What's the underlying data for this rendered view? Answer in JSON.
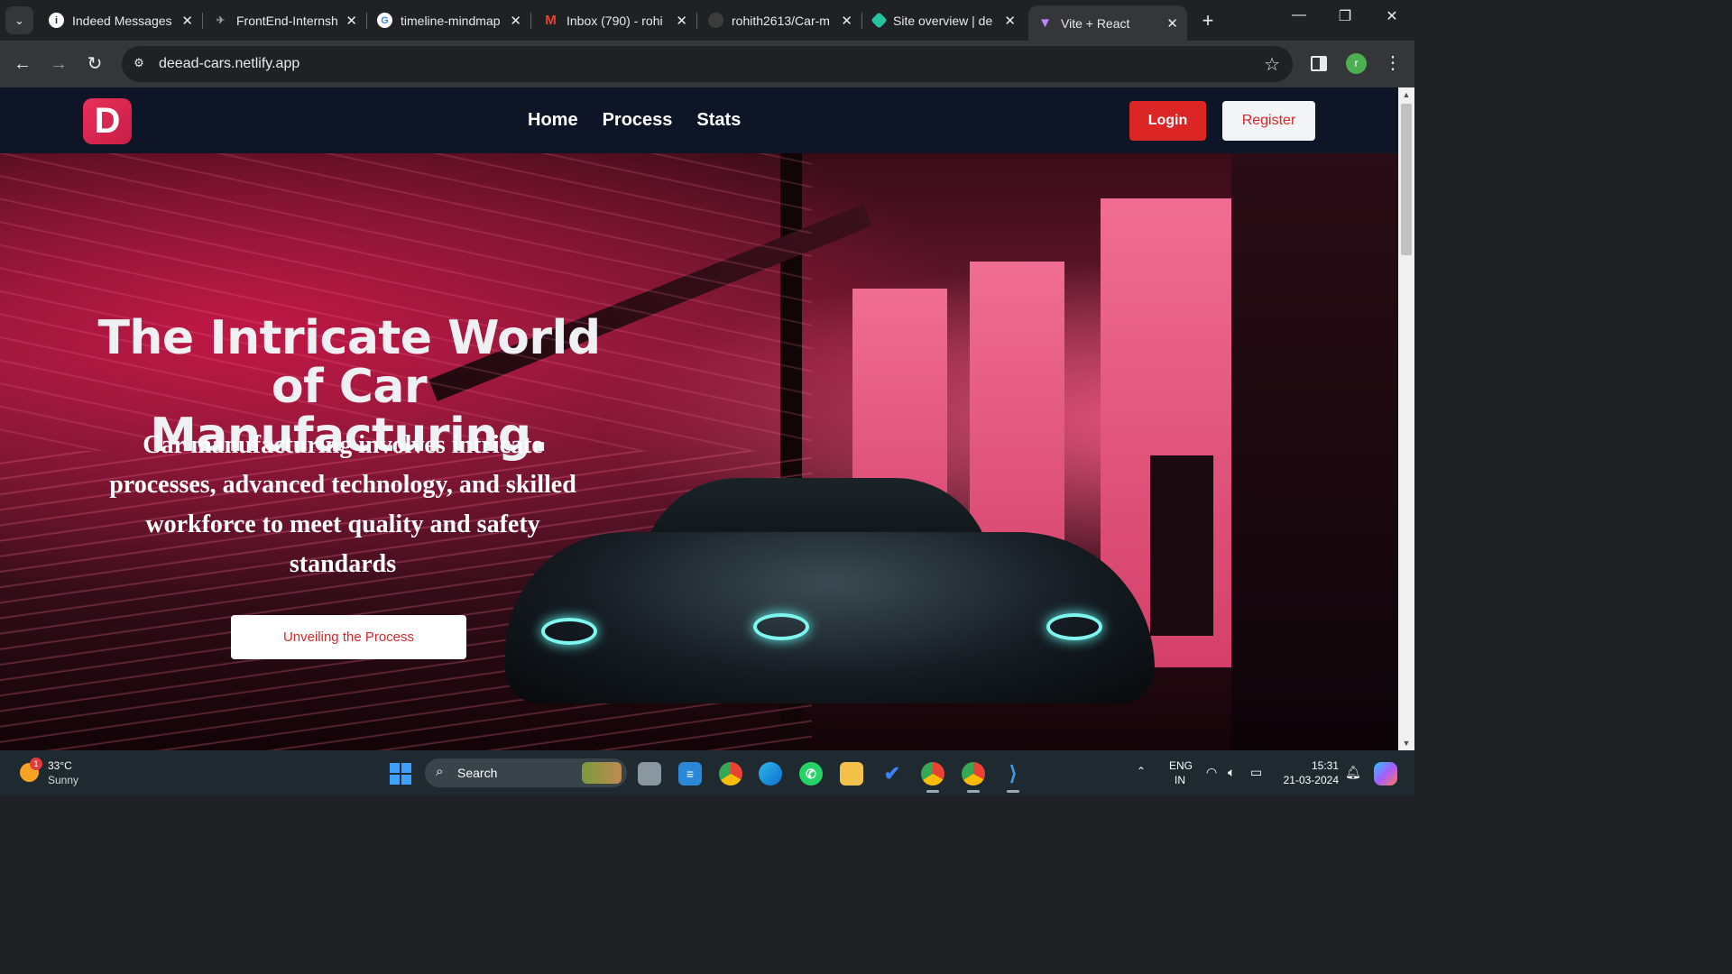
{
  "browser": {
    "tabs": [
      {
        "title": "Indeed Messages",
        "icon": "info-icon",
        "color": "#ffffff"
      },
      {
        "title": "FrontEnd-Internsh",
        "icon": "internshala-icon",
        "color": "#9aa0a6"
      },
      {
        "title": "timeline-mindmap",
        "icon": "google-icon",
        "color": "#4285f4"
      },
      {
        "title": "Inbox (790) - rohi",
        "icon": "gmail-icon",
        "color": "#ea4335"
      },
      {
        "title": "rohith2613/Car-m",
        "icon": "github-icon",
        "color": "#3c3c3c"
      },
      {
        "title": "Site overview | de",
        "icon": "netlify-icon",
        "color": "#25c2a0"
      },
      {
        "title": "Vite + React",
        "icon": "vite-icon",
        "color": "#a855f7",
        "active": true
      }
    ],
    "url": "deead-cars.netlify.app",
    "profile_initial": "r"
  },
  "site": {
    "logo_letter": "D",
    "nav": [
      "Home",
      "Process",
      "Stats"
    ],
    "login": "Login",
    "register": "Register",
    "hero": {
      "title_line1": "The Intricate World",
      "title_line2": "of Car Manufacturing.",
      "subtitle": "Car manufacturing involves intricate processes, advanced technology, and skilled workforce to meet quality and safety standards",
      "cta": "Unveiling the Process"
    },
    "colors": {
      "accent": "#dc2626",
      "nav_bg": "#0d1526",
      "logo": "#e8305a"
    }
  },
  "taskbar": {
    "weather": {
      "temp": "33°C",
      "condition": "Sunny",
      "badge": "1"
    },
    "search_label": "Search",
    "lang_line1": "ENG",
    "lang_line2": "IN",
    "time": "15:31",
    "date": "21-03-2024"
  }
}
